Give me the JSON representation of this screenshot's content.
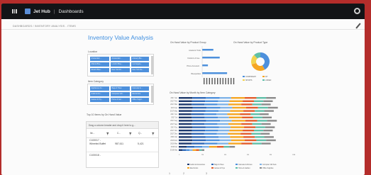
{
  "header": {
    "app_name": "Jet Hub",
    "separator": "|",
    "section": "Dashboards"
  },
  "breadcrumb": "DASHBOARDS / INVENTORY ANALYSIS - ITEMS",
  "dashboard": {
    "title": "Inventory Value Analysis",
    "location_label": "Location",
    "item_category_label": "Item Category",
    "top_items_label": "Top 10 Items by On Hand Value",
    "group_hint": "Drag a column header and drop it here to g...",
    "columns": [
      "Ite...",
      "C...",
      "Q..."
    ],
    "rows": [
      [
        "C100017 - Wheeled Buffet",
        "987,611",
        "5,421"
      ],
      [
        "C100018 -",
        "",
        ""
      ]
    ],
    "location_tiles": [
      "Amsterdam ...",
      "Amsterdam ...",
      "Antwerp Blu...",
      "Atlanta Blue...",
      "London Blue...",
      "Los Angele...",
      "Munich Blue...",
      "New York Bl...",
      "New York Re..."
    ],
    "category_tiles": [
      "Appliances Ac...",
      "Bags & Totes",
      "Cameras & ...",
      "Audio & Acc...",
      "Computer Gift...",
      "Electronics",
      "Games & Toy...",
      "Home & Gar...",
      "Office Suppl..."
    ]
  },
  "chart_data": [
    {
      "type": "bar",
      "title": "On Hand Value by Product Group",
      "categories": [
        "Academic Trails",
        "Outdoors & Fea...",
        "Phone Accessori...",
        "Bluesparkles"
      ],
      "values": [
        0.35,
        0.55,
        0.18,
        0.78
      ]
    },
    {
      "type": "pie",
      "title": "On Hand Value by Product Type",
      "legend": [
        "COMPONENT",
        "KIT",
        "SPORTS",
        "LINKED"
      ],
      "values": [
        0.42,
        0.28,
        0.18,
        0.12
      ],
      "colors": [
        "#4d90dc",
        "#f6a623",
        "#f2d34f",
        "#5fbfa8"
      ]
    },
    {
      "type": "bar",
      "title": "On Hand Value by Month by Item Category",
      "categories": [
        "2017 Jan",
        "2017 Feb",
        "2017 Mar",
        "2017 Apr",
        "2017 May",
        "2017 Jun",
        "2017 Jul",
        "2017 Aug",
        "2017 Sep",
        "2017 Oct",
        "2017 Nov",
        "2017 Dec",
        "2018 Jan",
        "2018 Feb",
        "2018 Mar",
        "2018 Apr",
        "2018 May"
      ],
      "series_colors": [
        "#1f3a6e",
        "#2f68b6",
        "#4d90dc",
        "#7fb3e8",
        "#f6a623",
        "#e35d2c",
        "#5fbfa8",
        "#8a8a8a"
      ],
      "legend": [
        "Audio & Accessories",
        "Bags & Totes",
        "Cameras & Drones",
        "Computer Gift Sets",
        "Electronics",
        "Games & Toys",
        "Home & Garden",
        "Office Supplies"
      ],
      "x_ticks": [
        "0",
        "2M",
        "4M",
        "6M",
        "8M",
        "10M"
      ]
    }
  ],
  "pager": [
    "1",
    "2",
    "3"
  ]
}
